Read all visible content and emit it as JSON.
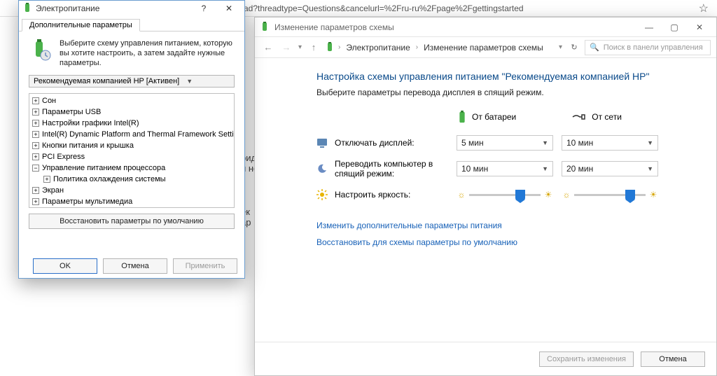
{
  "browser": {
    "url_fragment": "ad?threadtype=Questions&cancelurl=%2Fru-ru%2Fpage%2Fgettingstarted"
  },
  "control_panel": {
    "window_title": "Изменение параметров схемы",
    "breadcrumbs": [
      "Электропитание",
      "Изменение параметров схемы"
    ],
    "search_placeholder": "Поиск в панели управления",
    "heading": "Настройка схемы управления питанием \"Рекомендуемая компанией HP\"",
    "subheading": "Выберите параметры перевода дисплея в спящий режим.",
    "col_battery": "От батареи",
    "col_ac": "От сети",
    "rows": {
      "display_off": {
        "label": "Отключать дисплей:",
        "battery": "5 мин",
        "ac": "10 мин"
      },
      "sleep": {
        "label": "Переводить компьютер в спящий режим:",
        "battery": "10 мин",
        "ac": "20 мин"
      },
      "brightness": {
        "label": "Настроить яркость:"
      }
    },
    "link_advanced": "Изменить дополнительные параметры питания",
    "link_restore": "Восстановить для схемы параметры по умолчанию",
    "btn_save": "Сохранить изменения",
    "btn_cancel": "Отмена"
  },
  "advanced": {
    "window_title": "Электропитание",
    "tab": "Дополнительные параметры",
    "intro": "Выберите схему управления питанием, которую вы хотите настроить, а затем задайте нужные параметры.",
    "plan": "Рекомендуемая компанией HP [Активен]",
    "tree": [
      "Сон",
      "Параметры USB",
      "Настройки графики Intel(R)",
      "Intel(R) Dynamic Platform and Thermal Framework Settings",
      "Кнопки питания и крышка",
      "PCI Express",
      "Управление питанием процессора",
      "Политика охлаждения системы",
      "Экран",
      "Параметры мультимедиа"
    ],
    "expanded_index": 6,
    "restore": "Восстановить параметры по умолчанию",
    "ok": "OK",
    "cancel": "Отмена",
    "apply": "Применить"
  },
  "under": {
    "t1": "рид",
    "t2": "и но",
    "t3": "ек",
    "t4": "ар"
  }
}
